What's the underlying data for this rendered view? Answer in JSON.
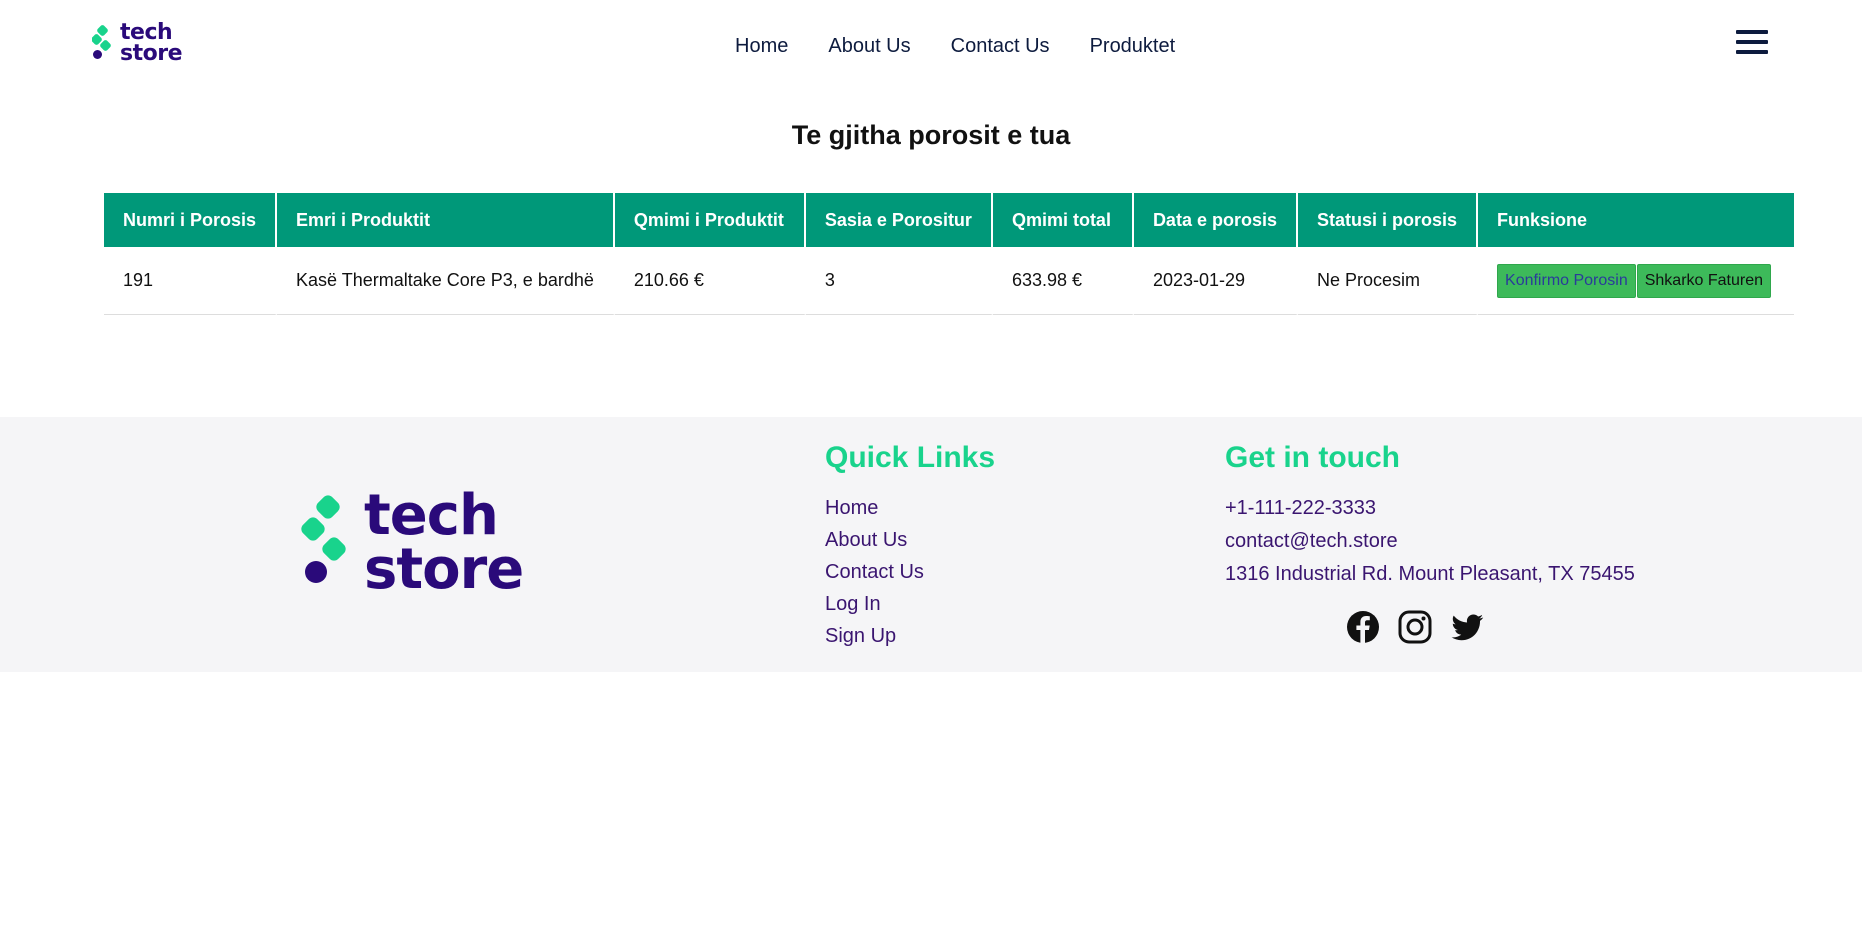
{
  "brand": {
    "line1": "tech",
    "line2": "store",
    "accent": "#19d38c",
    "primary": "#2a0a7a"
  },
  "nav": {
    "items": [
      "Home",
      "About Us",
      "Contact Us",
      "Produktet"
    ],
    "menu_icon": "hamburger-icon"
  },
  "page_title": "Te gjitha porosit e tua",
  "table": {
    "header_color": "#009879",
    "headers": [
      "Numri i Porosis",
      "Emri i Produktit",
      "Qmimi i Produktit",
      "Sasia e Porositur",
      "Qmimi total",
      "Data e porosis",
      "Statusi i porosis",
      "Funksione"
    ],
    "rows": [
      {
        "order_no": "191",
        "product": "Kasë Thermaltake Core P3, e bardhë",
        "price": "210.66 €",
        "quantity": "3",
        "total": "633.98 €",
        "date": "2023-01-29",
        "status": "Ne Procesim",
        "actions": [
          "Konfirmo Porosin",
          "Shkarko Faturen"
        ]
      }
    ]
  },
  "footer": {
    "quick_links_title": "Quick Links",
    "quick_links": [
      "Home",
      "About Us",
      "Contact Us",
      "Log In",
      "Sign Up"
    ],
    "contact_title": "Get in touch",
    "phone": "+1-111-222-3333",
    "email": "contact@tech.store",
    "address": "1316 Industrial Rd. Mount Pleasant, TX 75455",
    "socials": [
      "facebook-icon",
      "instagram-icon",
      "twitter-icon"
    ]
  }
}
